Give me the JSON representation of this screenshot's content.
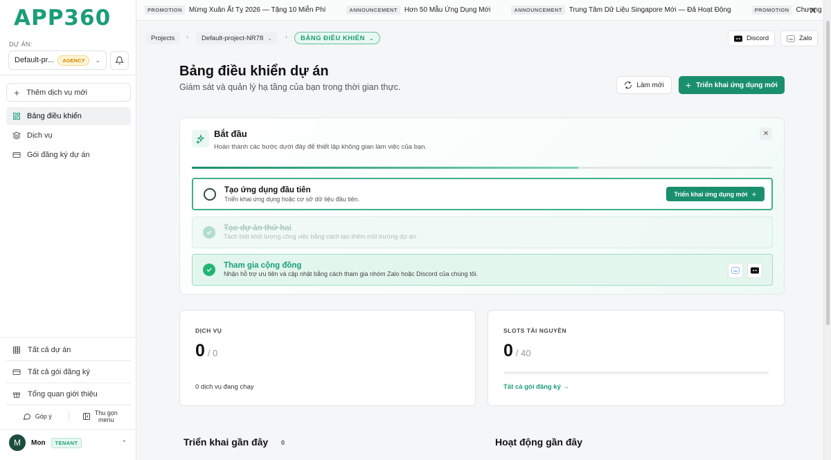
{
  "brand": {
    "logo_text": "APP360"
  },
  "sidebar": {
    "project_label": "DỰ ÁN:",
    "project_name": "Default-pr...",
    "project_badge": "AGENCY",
    "add_service": "Thêm dịch vụ mới",
    "nav": [
      {
        "label": "Bảng điều khiển",
        "icon": "dashboard-icon",
        "active": true
      },
      {
        "label": "Dịch vụ",
        "icon": "layers-icon"
      },
      {
        "label": "Gói đăng ký dự án",
        "icon": "card-icon"
      }
    ],
    "bottom": [
      {
        "label": "Tất cả dự án",
        "icon": "grid-icon"
      },
      {
        "label": "Tất cả gói đăng ký",
        "icon": "card-icon"
      },
      {
        "label": "Tổng quan giới thiệu",
        "icon": "gift-icon"
      }
    ],
    "feedback": "Góp ý",
    "collapse_line1": "Thu gọn",
    "collapse_line2": "menu",
    "user": {
      "initial": "M",
      "name": "Mon",
      "role": "TENANT"
    }
  },
  "ticker": [
    {
      "tag": "PROMOTION",
      "text": "Mừng Xuân Ất Tỵ 2026 — Tặng 10 Miễn Phí"
    },
    {
      "tag": "ANNOUNCEMENT",
      "text": "Hơn 50 Mẫu Ứng Dụng Mới"
    },
    {
      "tag": "ANNOUNCEMENT",
      "text": "Trung Tâm Dữ Liệu Singapore Mới — Đã Hoạt Động"
    },
    {
      "tag": "PROMOTION",
      "text": "Chương Trì"
    }
  ],
  "breadcrumb": {
    "projects": "Projects",
    "project": "Default-project-NR78",
    "current": "BẢNG ĐIỀU KHIỂN"
  },
  "external": {
    "discord": "Discord",
    "zalo": "Zalo"
  },
  "header": {
    "title": "Bảng điều khiển dự án",
    "subtitle": "Giám sát và quản lý hạ tầng của bạn trong thời gian thực.",
    "refresh": "Làm mới",
    "deploy": "Triển khai ứng dụng mới"
  },
  "getting_started": {
    "title": "Bắt đầu",
    "subtitle": "Hoàn thành các bước dưới đây để thiết lập không gian làm việc của bạn.",
    "progress": 0.665,
    "steps": [
      {
        "title": "Tạo ứng dụng đầu tiên",
        "desc": "Triển khai ứng dụng hoặc cơ sở dữ liệu đầu tiên.",
        "button": "Triển khai ứng dụng mới",
        "done": false
      },
      {
        "title": "Tạo dự án thứ hai",
        "desc": "Tách biệt khối lượng công việc bằng cách tạo thêm môi trường dự án.",
        "done": true
      },
      {
        "title": "Tham gia cộng đồng",
        "desc": "Nhận hỗ trợ ưu tiên và cập nhật bằng cách tham gia nhóm Zalo hoặc Discord của chúng tôi.",
        "done": true
      }
    ]
  },
  "stats": {
    "services": {
      "label": "DỊCH VỤ",
      "value": "0",
      "total": "/ 0",
      "footer": "0 dịch vụ đang chạy"
    },
    "slots": {
      "label": "SLOTS TÀI NGUYÊN",
      "value": "0",
      "total": "/ 40",
      "link": "Tất cả gói đăng ký →"
    }
  },
  "sections": {
    "recent_deploys": "Triển khai gần đây",
    "recent_deploys_count": "0",
    "recent_activity": "Hoạt động gần đây"
  },
  "colors": {
    "accent": "#1a8f6e",
    "brand": "#1a9d78"
  }
}
